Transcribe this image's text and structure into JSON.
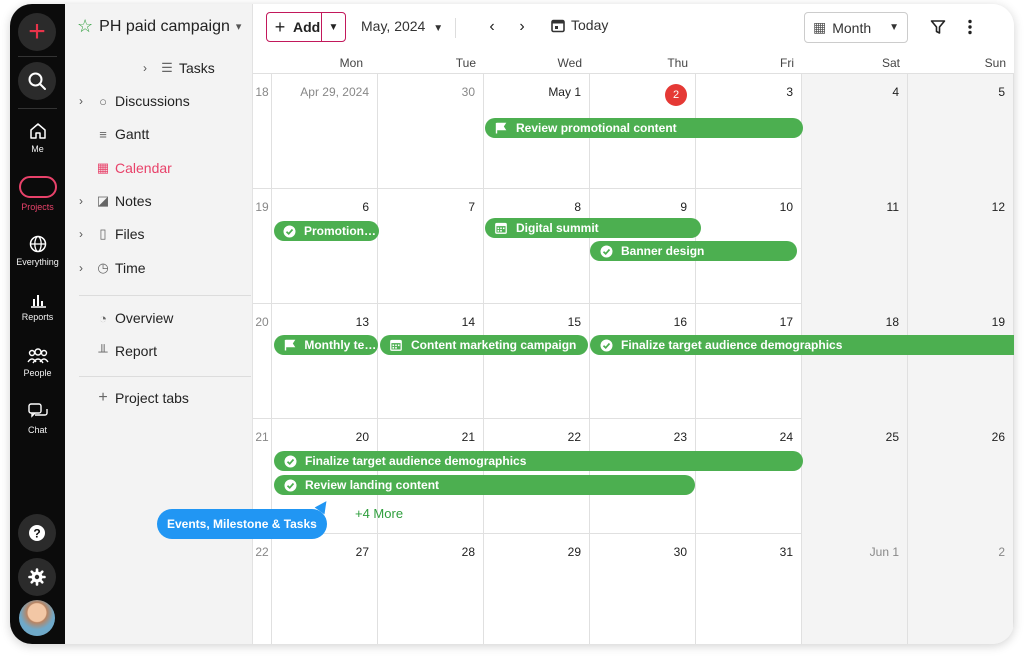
{
  "colors": {
    "accent": "#e8426a",
    "event_green": "#4caf50",
    "today_red": "#e53935",
    "tooltip_blue": "#2196f3"
  },
  "rail": {
    "add_icon": "plus-icon",
    "search_icon": "search-icon",
    "items": [
      {
        "label": "Me",
        "icon": "home-icon"
      },
      {
        "label": "Projects",
        "icon": "projects-icon"
      },
      {
        "label": "Everything",
        "icon": "globe-icon"
      },
      {
        "label": "Reports",
        "icon": "bar-chart-icon"
      },
      {
        "label": "People",
        "icon": "people-icon"
      },
      {
        "label": "Chat",
        "icon": "chat-icon"
      }
    ],
    "help_icon": "help-icon",
    "settings_icon": "gear-icon"
  },
  "sidebar": {
    "project_name": "PH paid campaign",
    "items": [
      {
        "label": "Tasks",
        "icon": "task-list-icon"
      },
      {
        "label": "Discussions",
        "icon": "speech-bubble-icon"
      },
      {
        "label": "Gantt",
        "icon": "gantt-icon"
      },
      {
        "label": "Calendar",
        "icon": "calendar-icon"
      },
      {
        "label": "Notes",
        "icon": "note-icon"
      },
      {
        "label": "Files",
        "icon": "file-icon"
      },
      {
        "label": "Time",
        "icon": "clock-icon"
      },
      {
        "label": "Overview",
        "icon": "gauge-icon"
      },
      {
        "label": "Report",
        "icon": "report-icon"
      },
      {
        "label": "Project tabs",
        "icon": "plus-icon"
      }
    ]
  },
  "toolbar": {
    "add_label": "Add",
    "period_label": "May, 2024",
    "today_label": "Today",
    "view_label": "Month"
  },
  "calendar": {
    "days_of_week": [
      "Mon",
      "Tue",
      "Wed",
      "Thu",
      "Fri",
      "Sat",
      "Sun"
    ],
    "weeks": [
      {
        "num": "18",
        "days": [
          "Apr 29, 2024",
          "30",
          "May 1",
          "2",
          "3",
          "4",
          "5"
        ]
      },
      {
        "num": "19",
        "days": [
          "6",
          "7",
          "8",
          "9",
          "10",
          "11",
          "12"
        ]
      },
      {
        "num": "20",
        "days": [
          "13",
          "14",
          "15",
          "16",
          "17",
          "18",
          "19"
        ]
      },
      {
        "num": "21",
        "days": [
          "20",
          "21",
          "22",
          "23",
          "24",
          "25",
          "26"
        ]
      },
      {
        "num": "22",
        "days": [
          "27",
          "28",
          "29",
          "30",
          "31",
          "Jun 1",
          "2"
        ]
      }
    ],
    "events": [
      {
        "title": "Review promotional content",
        "icon": "flag-icon"
      },
      {
        "title": "Promotion c...",
        "icon": "check-circle-icon"
      },
      {
        "title": "Digital summit",
        "icon": "calendar-event-icon"
      },
      {
        "title": "Banner design",
        "icon": "check-circle-icon"
      },
      {
        "title": "Monthly tea...",
        "icon": "flag-icon"
      },
      {
        "title": "Content marketing campaign",
        "icon": "calendar-event-icon"
      },
      {
        "title": "Finalize target audience demographics",
        "icon": "check-circle-icon"
      },
      {
        "title": "Finalize target audience demographics",
        "icon": "check-circle-icon"
      },
      {
        "title": "Review landing content",
        "icon": "check-circle-icon"
      }
    ],
    "more_label": "+4 More"
  },
  "tooltip": {
    "text": "Events, Milestone & Tasks"
  }
}
